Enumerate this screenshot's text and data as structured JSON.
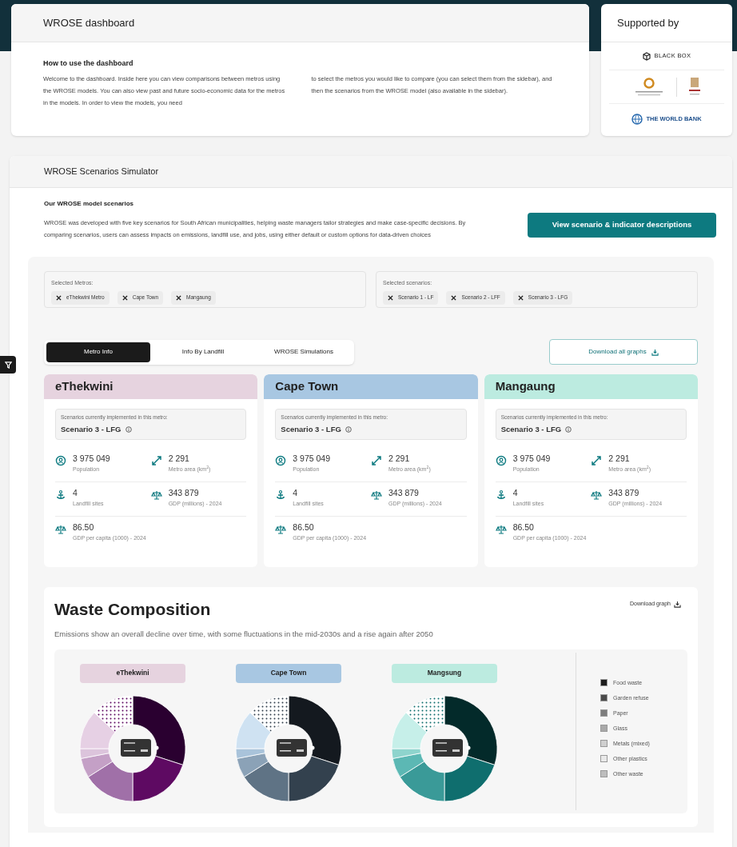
{
  "dashboard": {
    "title": "WROSE dashboard",
    "heading": "How to use the dashboard",
    "paragraphs": [
      "Welcome to the dashboard. Inside here you can view comparisons between metros using the WROSE models. You can also view past and future socio-economic data for the metros in the models. In order to view the models, you need",
      "to select the metros you would like to compare (you can select them from the sidebar), and then the scenarios from the WROSE model (also available in the sidebar)."
    ]
  },
  "supported_by": {
    "title": "Supported by",
    "black_box": "BLACK BOX",
    "world_bank": "THE WORLD BANK"
  },
  "simulator": {
    "title": "WROSE Scenarios Simulator",
    "heading": "Our WROSE model scenarios",
    "description": "WROSE was developed with five key scenarios for South African municipalities, helping waste managers tailor strategies and make case-specific decisions. By comparing scenarios, users can assess impacts on emissions, landfill use, and jobs, using either default or custom options for data-driven choices",
    "button": "View scenario & indicator descriptions"
  },
  "selected_metros": {
    "label": "Selected Metros:",
    "chips": [
      "eThekwini Metro",
      "Cape Town",
      "Mangaung"
    ]
  },
  "selected_scenarios": {
    "label": "Selected scenarios:",
    "chips": [
      "Scenario 1 - LF",
      "Scenario 2 - LFF",
      "Scenario 3 - LFG"
    ]
  },
  "tabs": [
    {
      "label": "Metro Info",
      "selected": true
    },
    {
      "label": "Info By Landfill",
      "selected": false
    },
    {
      "label": "WROSE Simulations",
      "selected": false
    }
  ],
  "download_all": "Download all graphs",
  "metros": [
    {
      "name": "eThekwini",
      "color": "#e6d3df",
      "scenario_label": "Scenarios currently implemented in this metro:",
      "scenario": "Scenario 3 - LFG",
      "stats": [
        {
          "kind": "population",
          "value": "3 975 049",
          "label": "Population"
        },
        {
          "kind": "area",
          "value": "2 291",
          "label": "Metro area (km$^{2}$)"
        },
        {
          "kind": "landfill",
          "value": "4",
          "label": "Landfill sites"
        },
        {
          "kind": "gdp",
          "value": "343 879",
          "label": "GDP (millions) - 2024"
        },
        {
          "kind": "gdp",
          "value": "86.50",
          "label": "GDP per capita (1000) - 2024"
        }
      ]
    },
    {
      "name": "Cape Town",
      "color": "#a8c7e2",
      "scenario_label": "Scenarios currently implemented in this metro:",
      "scenario": "Scenario 3 - LFG",
      "stats": [
        {
          "kind": "population",
          "value": "3 975 049",
          "label": "Population"
        },
        {
          "kind": "area",
          "value": "2 291",
          "label": "Metro area (km$^{2}$)"
        },
        {
          "kind": "landfill",
          "value": "4",
          "label": "Landfill sites"
        },
        {
          "kind": "gdp",
          "value": "343 879",
          "label": "GDP (millions) - 2024"
        },
        {
          "kind": "gdp",
          "value": "86.50",
          "label": "GDP per capita (1000) - 2024"
        }
      ]
    },
    {
      "name": "Mangaung",
      "color": "#bcebe0",
      "scenario_label": "Scenarios currently implemented in this metro:",
      "scenario": "Scenario 3 - LFG",
      "stats": [
        {
          "kind": "population",
          "value": "3 975 049",
          "label": "Population"
        },
        {
          "kind": "area",
          "value": "2 291",
          "label": "Metro area (km$^{2}$)"
        },
        {
          "kind": "landfill",
          "value": "4",
          "label": "Landfill sites"
        },
        {
          "kind": "gdp",
          "value": "343 879",
          "label": "GDP (millions) - 2024"
        },
        {
          "kind": "gdp",
          "value": "86.50",
          "label": "GDP per capita (1000) - 2024"
        }
      ]
    }
  ],
  "waste_composition": {
    "title": "Waste Composition",
    "subtitle": "Emissions show an overall decline over time, with some fluctuations in the mid-2030s and a rise again after 2050",
    "download": "Download graph",
    "charts": [
      {
        "label": "eThekwini",
        "color": "#e6d3df"
      },
      {
        "label": "Cape Town",
        "color": "#a8c7e2"
      },
      {
        "label": "Mangsung",
        "color": "#bcebe0"
      }
    ],
    "legend": [
      {
        "label": "Food waste",
        "color": "#1c1c1c"
      },
      {
        "label": "Garden refuse",
        "color": "#4a4a4a"
      },
      {
        "label": "Paper",
        "color": "#7d7d7d"
      },
      {
        "label": "Glass",
        "color": "#a8a8a8"
      },
      {
        "label": "Metals (mixed)",
        "color": "#cfcfcf"
      },
      {
        "label": "Other plastics",
        "color": "#e9e9e9"
      },
      {
        "label": "Other waste",
        "color": "#bdbdbd"
      }
    ]
  }
}
